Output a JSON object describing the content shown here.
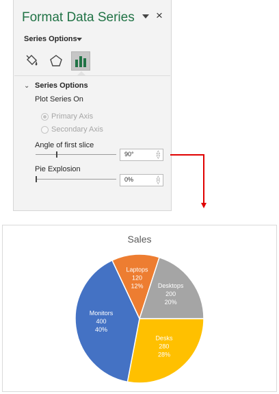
{
  "pane": {
    "title": "Format Data Series",
    "close_glyph": "×",
    "dropdown_label": "Series Options",
    "tabs": [
      {
        "name": "Fill & Line",
        "icon": "paint-bucket-icon"
      },
      {
        "name": "Effects",
        "icon": "pentagon-icon"
      },
      {
        "name": "Series Options",
        "icon": "bar-chart-icon",
        "active": true
      }
    ],
    "section_header": "Series Options",
    "plot_series_on": "Plot Series On",
    "primary_axis": "Primary Axis",
    "secondary_axis": "Secondary Axis",
    "primary_checked": true,
    "angle_label": "Angle of first slice",
    "angle_value": "90°",
    "angle_slider_fraction": 0.25,
    "explosion_label": "Pie Explosion",
    "explosion_value": "0%",
    "explosion_slider_fraction": 0,
    "accent_color": "#217346"
  },
  "connector_color": "#e00000",
  "chart_data": {
    "type": "pie",
    "title": "Sales",
    "first_slice_angle_deg": 90,
    "slices": [
      {
        "name": "Desks",
        "value": 280,
        "percent": "28%",
        "color": "#ffc000"
      },
      {
        "name": "Monitors",
        "value": 400,
        "percent": "40%",
        "color": "#4472c4"
      },
      {
        "name": "Laptops",
        "value": 120,
        "percent": "12%",
        "color": "#ed7d31"
      },
      {
        "name": "Desktops",
        "value": 200,
        "percent": "20%",
        "color": "#a5a5a5"
      }
    ]
  }
}
